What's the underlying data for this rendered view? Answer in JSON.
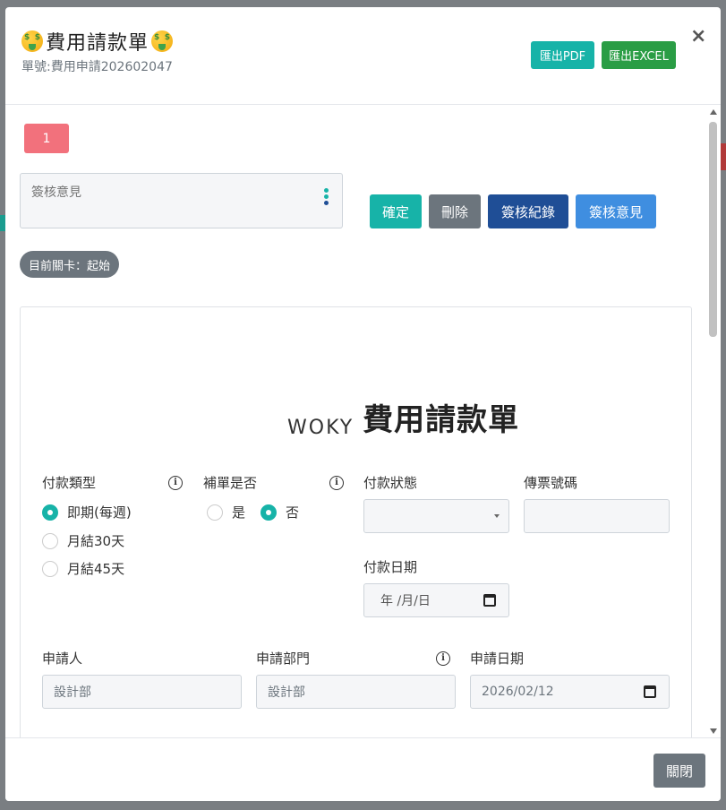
{
  "header": {
    "title": "費用請款單",
    "form_no": "單號:費用申請202602047",
    "export_pdf": "匯出PDF",
    "export_excel": "匯出EXCEL",
    "close_symbol": "×"
  },
  "toolbar": {
    "stage_number": "1",
    "opinion_placeholder": "簽核意見",
    "confirm": "確定",
    "delete": "刪除",
    "approval_log": "簽核紀錄",
    "approval_opinion": "簽核意見",
    "current_stage": "目前關卡：起始"
  },
  "form": {
    "logo": "WOKY",
    "title": "費用請款單",
    "payment_type": {
      "label": "付款類型",
      "options": [
        "即期(每週)",
        "月結30天",
        "月結45天"
      ],
      "selected": "即期(每週)"
    },
    "supplement": {
      "label": "補單是否",
      "options": [
        "是",
        "否"
      ],
      "selected": "否"
    },
    "payment_status": {
      "label": "付款狀態",
      "value": ""
    },
    "voucher_no": {
      "label": "傳票號碼",
      "value": ""
    },
    "payment_date": {
      "label": "付款日期",
      "placeholder": "年 /月/日"
    },
    "applicant": {
      "label": "申請人",
      "value": "設計部"
    },
    "department": {
      "label": "申請部門",
      "value": "設計部"
    },
    "apply_date": {
      "label": "申請日期",
      "value": "2026/02/12"
    }
  },
  "footer": {
    "close": "關閉"
  },
  "colors": {
    "teal": "#17b3a8",
    "green": "#2a9d45",
    "gray": "#6c757d",
    "navy": "#1f4e96",
    "blue": "#3f8ee0",
    "pink": "#f2717c"
  }
}
